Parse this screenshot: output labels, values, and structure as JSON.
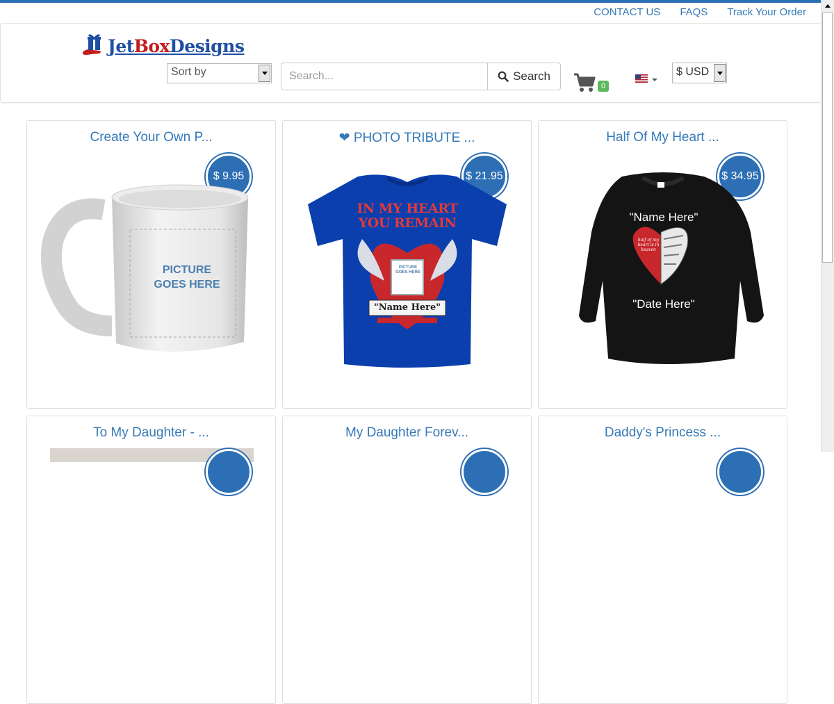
{
  "toplinks": {
    "contact": "CONTACT US",
    "faqs": "FAQS",
    "track": "Track Your Order"
  },
  "logo": {
    "part1": "Jet",
    "part2": "Box",
    "part3": "Designs"
  },
  "sort": {
    "label": "Sort by"
  },
  "search": {
    "placeholder": "Search...",
    "button": "Search"
  },
  "cart": {
    "count": "0"
  },
  "currency": {
    "selected": "$ USD"
  },
  "products": [
    {
      "title": "Create Your Own P...",
      "price": "$ 9.95",
      "image_text": "PICTURE GOES HERE"
    },
    {
      "title": "❤ PHOTO TRIBUTE ...",
      "price": "$ 21.95",
      "image_text": {
        "line1": "IN MY HEART",
        "line2": "YOU REMAIN",
        "name": "\"Name Here\"",
        "pic": "PICTURE GOES HERE"
      }
    },
    {
      "title": "Half Of My Heart ...",
      "price": "$ 34.95",
      "image_text": {
        "name": "\"Name Here\"",
        "date": "\"Date Here\"",
        "script": "half of my heart is in heaven"
      }
    },
    {
      "title": "To My Daughter - ..."
    },
    {
      "title": "My Daughter Forev..."
    },
    {
      "title": "Daddy's Princess ..."
    }
  ],
  "colors": {
    "accent": "#2d6fb4",
    "link": "#3579b8",
    "badge": "#5cb85c"
  }
}
